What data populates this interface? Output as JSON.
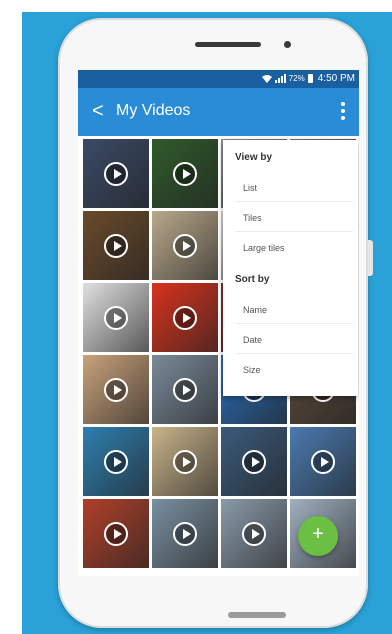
{
  "status_bar": {
    "battery": "72%",
    "time": "4:50 PM",
    "icons": [
      "wifi-icon",
      "signal-icon",
      "battery-icon"
    ]
  },
  "app_bar": {
    "back_icon": "chevron-left-icon",
    "back_glyph": "<",
    "title": "My Videos",
    "overflow_icon": "more-vert-icon"
  },
  "menu": {
    "view_header": "View by",
    "view_options": [
      "List",
      "Tiles",
      "Large tiles"
    ],
    "sort_header": "Sort by",
    "sort_options": [
      "Name",
      "Date",
      "Size"
    ]
  },
  "videos": [
    {
      "icon": "play-icon",
      "color": "#3a4a66"
    },
    {
      "icon": "play-icon",
      "color": "#2f5a2a"
    },
    {
      "icon": "play-icon",
      "color": "#8a8f94"
    },
    {
      "icon": "play-icon",
      "color": "#6f7378"
    },
    {
      "icon": "play-icon",
      "color": "#6a4a2a"
    },
    {
      "icon": "play-icon",
      "color": "#b9a98c"
    },
    {
      "icon": "play-icon",
      "color": "#d6d6d6"
    },
    {
      "icon": "play-icon",
      "color": "#a29c93"
    },
    {
      "icon": "play-icon",
      "color": "#e0e0e0"
    },
    {
      "icon": "play-icon",
      "color": "#d8321e"
    },
    {
      "icon": "play-icon",
      "color": "#8a2a2a"
    },
    {
      "icon": "play-icon",
      "color": "#4a5a6a"
    },
    {
      "icon": "play-icon",
      "color": "#c9a27a"
    },
    {
      "icon": "play-icon",
      "color": "#7a8a9a"
    },
    {
      "icon": "play-icon",
      "color": "#2a6db8"
    },
    {
      "icon": "play-icon",
      "color": "#5a4a3a"
    },
    {
      "icon": "play-icon",
      "color": "#2e7fb0"
    },
    {
      "icon": "play-icon",
      "color": "#c9b38a"
    },
    {
      "icon": "play-icon",
      "color": "#3a5a7a"
    },
    {
      "icon": "play-icon",
      "color": "#4a7ab0"
    },
    {
      "icon": "play-icon",
      "color": "#b0402a"
    },
    {
      "icon": "play-icon",
      "color": "#7a8fa0"
    },
    {
      "icon": "play-icon",
      "color": "#8a9aaa"
    },
    {
      "icon": "play-icon",
      "color": "#a0b0c0"
    }
  ],
  "fab": {
    "icon": "add-icon",
    "glyph": "+",
    "color": "#6abf44"
  },
  "colors": {
    "background": "#2aa2d8",
    "status_bar": "#1a5fa0",
    "app_bar": "#2a8bd6",
    "accent": "#6abf44"
  }
}
